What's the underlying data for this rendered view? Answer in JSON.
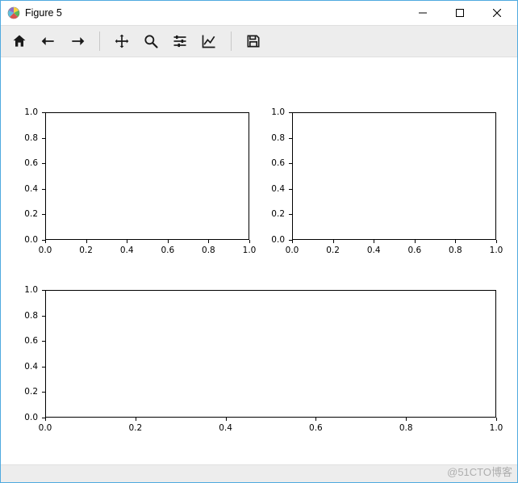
{
  "window": {
    "title": "Figure 5",
    "controls": {
      "minimize": "minimize",
      "maximize": "maximize",
      "close": "close"
    }
  },
  "toolbar": {
    "home": "Home",
    "back": "Back",
    "forward": "Forward",
    "pan": "Pan",
    "zoom": "Zoom",
    "configure": "Configure subplots",
    "axes": "Edit axis",
    "save": "Save"
  },
  "watermark": "@51CTO博客",
  "chart_data": [
    {
      "type": "line",
      "position": "top-left",
      "xlim": [
        0.0,
        1.0
      ],
      "ylim": [
        0.0,
        1.0
      ],
      "xticks": [
        0.0,
        0.2,
        0.4,
        0.6,
        0.8,
        1.0
      ],
      "yticks": [
        0.0,
        0.2,
        0.4,
        0.6,
        0.8,
        1.0
      ],
      "xtick_labels": [
        "0.0",
        "0.2",
        "0.4",
        "0.6",
        "0.8",
        "1.0"
      ],
      "ytick_labels": [
        "0.0",
        "0.2",
        "0.4",
        "0.6",
        "0.8",
        "1.0"
      ],
      "series": []
    },
    {
      "type": "line",
      "position": "top-right",
      "xlim": [
        0.0,
        1.0
      ],
      "ylim": [
        0.0,
        1.0
      ],
      "xticks": [
        0.0,
        0.2,
        0.4,
        0.6,
        0.8,
        1.0
      ],
      "yticks": [
        0.0,
        0.2,
        0.4,
        0.6,
        0.8,
        1.0
      ],
      "xtick_labels": [
        "0.0",
        "0.2",
        "0.4",
        "0.6",
        "0.8",
        "1.0"
      ],
      "ytick_labels": [
        "0.0",
        "0.2",
        "0.4",
        "0.6",
        "0.8",
        "1.0"
      ],
      "series": []
    },
    {
      "type": "line",
      "position": "bottom-wide",
      "xlim": [
        0.0,
        1.0
      ],
      "ylim": [
        0.0,
        1.0
      ],
      "xticks": [
        0.0,
        0.2,
        0.4,
        0.6,
        0.8,
        1.0
      ],
      "yticks": [
        0.0,
        0.2,
        0.4,
        0.6,
        0.8,
        1.0
      ],
      "xtick_labels": [
        "0.0",
        "0.2",
        "0.4",
        "0.6",
        "0.8",
        "1.0"
      ],
      "ytick_labels": [
        "0.0",
        "0.2",
        "0.4",
        "0.6",
        "0.8",
        "1.0"
      ],
      "series": []
    }
  ]
}
